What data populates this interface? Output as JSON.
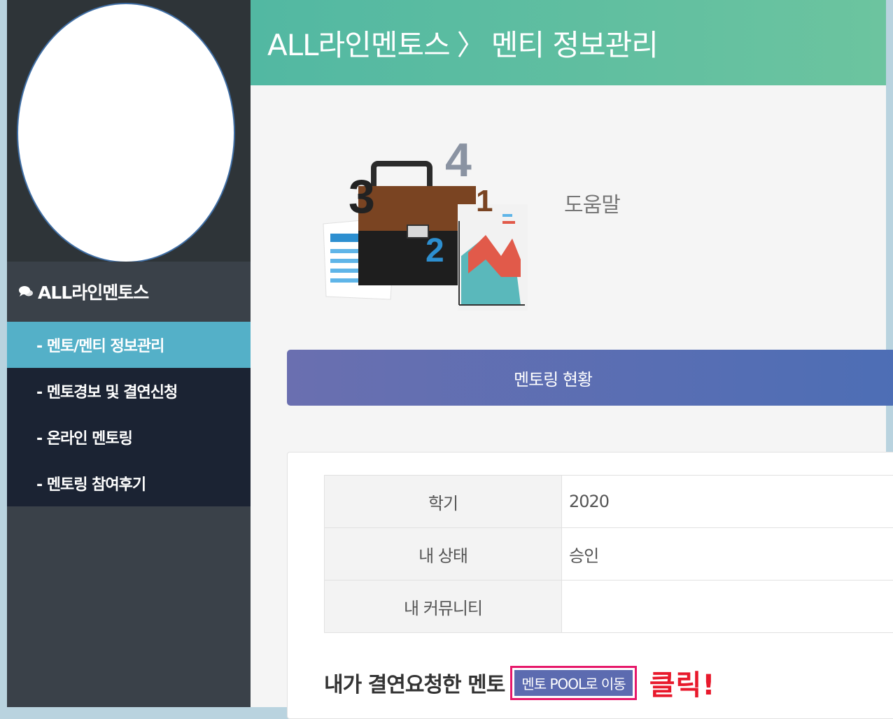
{
  "sidebar": {
    "section_title": "ALL라인멘토스",
    "items": [
      {
        "label": "- 멘토/멘티 정보관리",
        "active": true
      },
      {
        "label": "- 멘토경보 및 결연신청",
        "active": false
      },
      {
        "label": "- 온라인 멘토링",
        "active": false
      },
      {
        "label": "- 멘토링 참여후기",
        "active": false
      }
    ]
  },
  "header": {
    "app": "ALL라인멘토스",
    "separator": "〉",
    "page": "멘티 정보관리"
  },
  "illustration": {
    "n1": "1",
    "n2": "2",
    "n3": "3",
    "n4": "4"
  },
  "help_label": "도움말",
  "status_bar_label": "멘토링 현황",
  "info_table": {
    "rows": [
      {
        "label": "학기",
        "value": "2020"
      },
      {
        "label": "내 상태",
        "value": "승인"
      },
      {
        "label": "내 커뮤니티",
        "value": ""
      }
    ]
  },
  "mentor_section": {
    "title": "내가 결연요청한 멘토",
    "pool_button": "멘토 POOL로 이동",
    "click_note": "클릭!"
  },
  "colors": {
    "sidebar_dark": "#2e3438",
    "menu_bg": "#1b2333",
    "menu_active": "#54b0c8",
    "header_teal": "#52b8a2",
    "status_bar": "#5c6bb0",
    "highlight": "#e6186a",
    "click_note": "#e8192c"
  }
}
